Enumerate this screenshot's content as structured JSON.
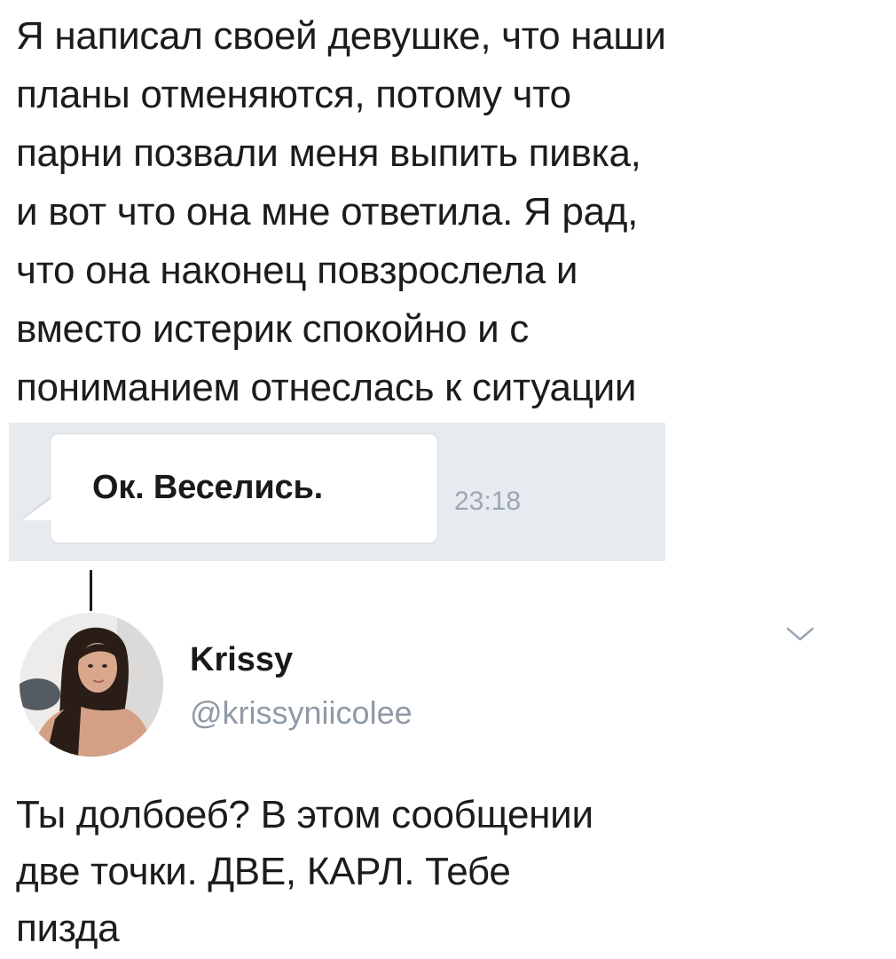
{
  "post": {
    "lines": [
      "Я написал своей девушке, что наши",
      "планы отменяются, потому что",
      "парни позвали меня выпить пивка,",
      "и вот что она мне ответила. Я рад,",
      "что она наконец повзрослела и",
      "вместо истерик спокойно и с",
      "пониманием отнеслась к ситуации"
    ]
  },
  "chat": {
    "message": "Ок. Веселись.",
    "time": "23:18",
    "background_color": "#e7ebef"
  },
  "reply_user": {
    "name": "Krissy",
    "handle": "@krissyniicolee",
    "avatar_icon": "user-avatar-photo",
    "menu_icon": "chevron-down-icon"
  },
  "reply": {
    "lines": [
      "Ты долбоеб? В этом сообщении",
      "две точки. ДВЕ, КАРЛ. Тебе",
      "пизда"
    ]
  },
  "colors": {
    "text": "#1c1c1c",
    "muted": "#8f9aa5",
    "time": "#9aa7b5"
  }
}
